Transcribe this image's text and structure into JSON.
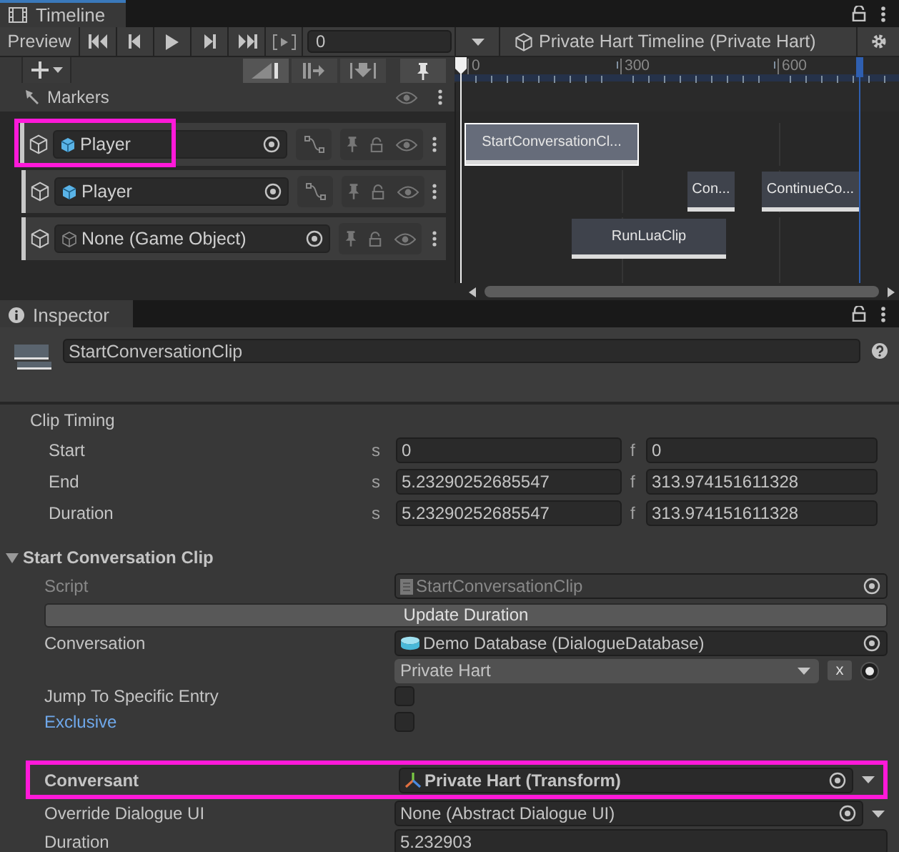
{
  "timeline": {
    "tab": "Timeline",
    "preview": "Preview",
    "frame": "0",
    "breadcrumb": "Private Hart Timeline (Private Hart)",
    "ruler_ticks": [
      "0",
      "300",
      "600"
    ],
    "markers": "Markers",
    "tracks": [
      {
        "kind": "binding",
        "binding": "Player",
        "highlighted": true,
        "clips": [
          {
            "label": "StartConversationCl...",
            "selected": true
          }
        ]
      },
      {
        "kind": "binding",
        "binding": "Player",
        "highlighted": false,
        "clips": [
          {
            "label": "Con...",
            "selected": false
          },
          {
            "label": "ContinueCo...",
            "selected": false
          }
        ]
      },
      {
        "kind": "none",
        "binding": "None (Game Object)",
        "highlighted": false,
        "clips": [
          {
            "label": "RunLuaClip",
            "selected": false
          }
        ]
      }
    ]
  },
  "inspector": {
    "tab": "Inspector",
    "name": "StartConversationClip",
    "clip_timing": {
      "title": "Clip Timing",
      "rows": [
        {
          "label": "Start",
          "s_unit": "s",
          "s": "0",
          "f_unit": "f",
          "f": "0"
        },
        {
          "label": "End",
          "s_unit": "s",
          "s": "5.23290252685547",
          "f_unit": "f",
          "f": "313.974151611328"
        },
        {
          "label": "Duration",
          "s_unit": "s",
          "s": "5.23290252685547",
          "f_unit": "f",
          "f": "313.974151611328"
        }
      ]
    },
    "section": {
      "title": "Start Conversation Clip",
      "expanded": true
    },
    "fields": [
      {
        "kind": "script",
        "label": "Script",
        "value": "StartConversationClip",
        "bold": false,
        "modified": false,
        "highlighted": false
      },
      {
        "kind": "button",
        "value": "Update Duration"
      },
      {
        "kind": "object",
        "label": "Conversation",
        "value": "Demo Database (DialogueDatabase)",
        "bold": false,
        "modified": false,
        "highlighted": false
      },
      {
        "kind": "popup",
        "value": "Private Hart",
        "clear": "x"
      },
      {
        "kind": "checkbox",
        "label": "Jump To Specific Entry",
        "checked": false,
        "bold": false,
        "modified": false,
        "highlighted": false
      },
      {
        "kind": "checkbox",
        "label": "Exclusive",
        "checked": false,
        "bold": false,
        "modified": true,
        "highlighted": false
      },
      {
        "kind": "spacer"
      },
      {
        "kind": "object",
        "label": "Conversant",
        "value": "Private Hart (Transform)",
        "bold": true,
        "modified": false,
        "highlighted": true
      },
      {
        "kind": "object",
        "label": "Override Dialogue UI",
        "value": "None (Abstract Dialogue UI)",
        "bold": false,
        "modified": false,
        "highlighted": false
      },
      {
        "kind": "text",
        "label": "Duration",
        "value": "5.232903",
        "bold": false,
        "modified": false,
        "highlighted": false
      }
    ]
  }
}
